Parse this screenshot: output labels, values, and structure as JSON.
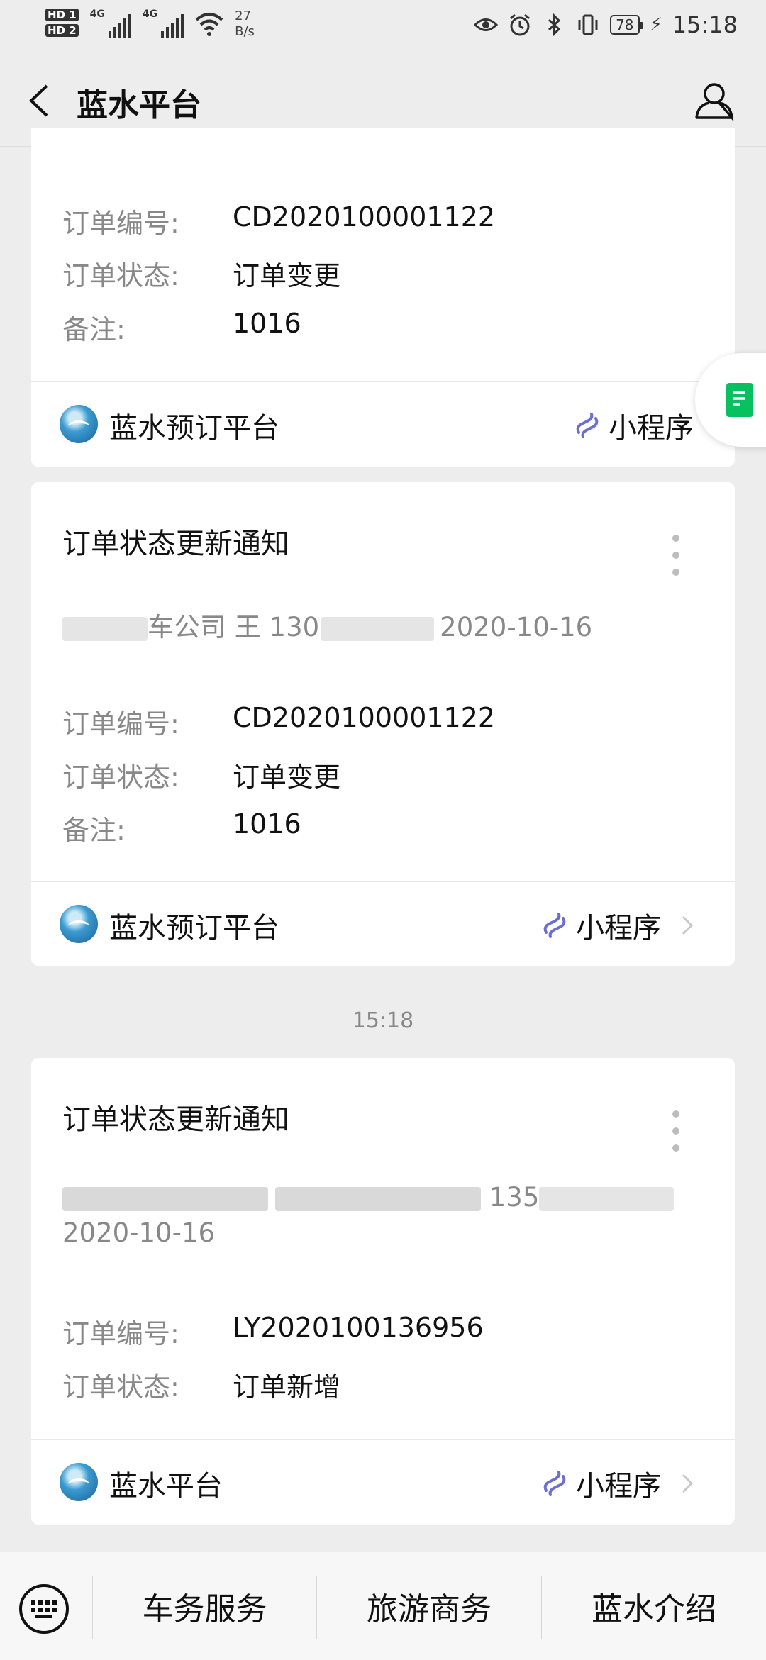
{
  "status_bar": {
    "hd1": "HD 1",
    "hd2": "HD 2",
    "net1": "4G",
    "net2": "4G",
    "speed_value": "27",
    "speed_unit": "B/s",
    "battery": "78",
    "time": "15:18"
  },
  "nav": {
    "title": "蓝水平台"
  },
  "cards": [
    {
      "rows": [
        {
          "label": "订单编号:",
          "value": "CD2020100001122"
        },
        {
          "label": "订单状态:",
          "value": "订单变更"
        },
        {
          "label": "备注:",
          "value": "1016"
        }
      ],
      "footer": {
        "platform": "蓝水预订平台",
        "mini_program": "小程序"
      }
    },
    {
      "title": "订单状态更新通知",
      "summary": {
        "part1": "车公司 王 130",
        "date": "2020-10-16"
      },
      "rows": [
        {
          "label": "订单编号:",
          "value": "CD2020100001122"
        },
        {
          "label": "订单状态:",
          "value": "订单变更"
        },
        {
          "label": "备注:",
          "value": "1016"
        }
      ],
      "footer": {
        "platform": "蓝水预订平台",
        "mini_program": "小程序"
      }
    },
    {
      "title": "订单状态更新通知",
      "summary": {
        "part1": "135",
        "date": "2020-10-16"
      },
      "rows": [
        {
          "label": "订单编号:",
          "value": "LY2020100136956"
        },
        {
          "label": "订单状态:",
          "value": "订单新增"
        }
      ],
      "footer": {
        "platform": "蓝水平台",
        "mini_program": "小程序"
      }
    }
  ],
  "timestamp": "15:18",
  "bottom_menu": [
    "车务服务",
    "旅游商务",
    "蓝水介绍"
  ]
}
